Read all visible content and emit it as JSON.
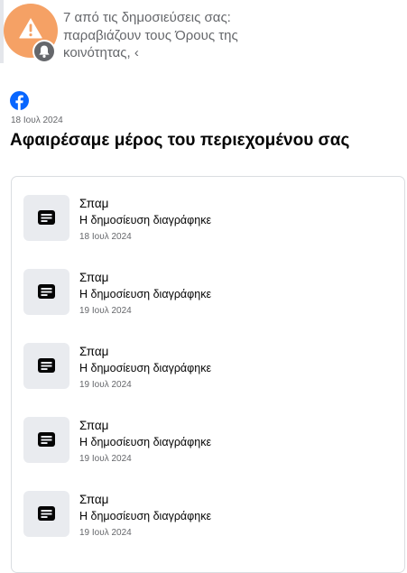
{
  "notification": {
    "text": "7 από τις δημοσιεύσεις σας: παραβιάζουν τους Όρους της κοινότητας, ‹",
    "avatar_icon": "warning-icon",
    "badge_icon": "bell-icon",
    "avatar_color": "#f5a165"
  },
  "header": {
    "logo_icon": "facebook-logo",
    "date": "18 Ιουλ 2024",
    "title": "Αφαιρέσαμε μέρος του περιεχομένου σας"
  },
  "items": [
    {
      "title": "Σπαμ",
      "status": "Η δημοσίευση διαγράφηκε",
      "date": "18 Ιουλ 2024",
      "icon": "post-icon"
    },
    {
      "title": "Σπαμ",
      "status": "Η δημοσίευση διαγράφηκε",
      "date": "19 Ιουλ 2024",
      "icon": "post-icon"
    },
    {
      "title": "Σπαμ",
      "status": "Η δημοσίευση διαγράφηκε",
      "date": "19 Ιουλ 2024",
      "icon": "post-icon"
    },
    {
      "title": "Σπαμ",
      "status": "Η δημοσίευση διαγράφηκε",
      "date": "19 Ιουλ 2024",
      "icon": "post-icon"
    },
    {
      "title": "Σπαμ",
      "status": "Η δημοσίευση διαγράφηκε",
      "date": "19 Ιουλ 2024",
      "icon": "post-icon"
    }
  ],
  "colors": {
    "facebook_blue": "#0866ff",
    "muted_text": "#65676b",
    "thumb_bg": "#e9ebef"
  }
}
